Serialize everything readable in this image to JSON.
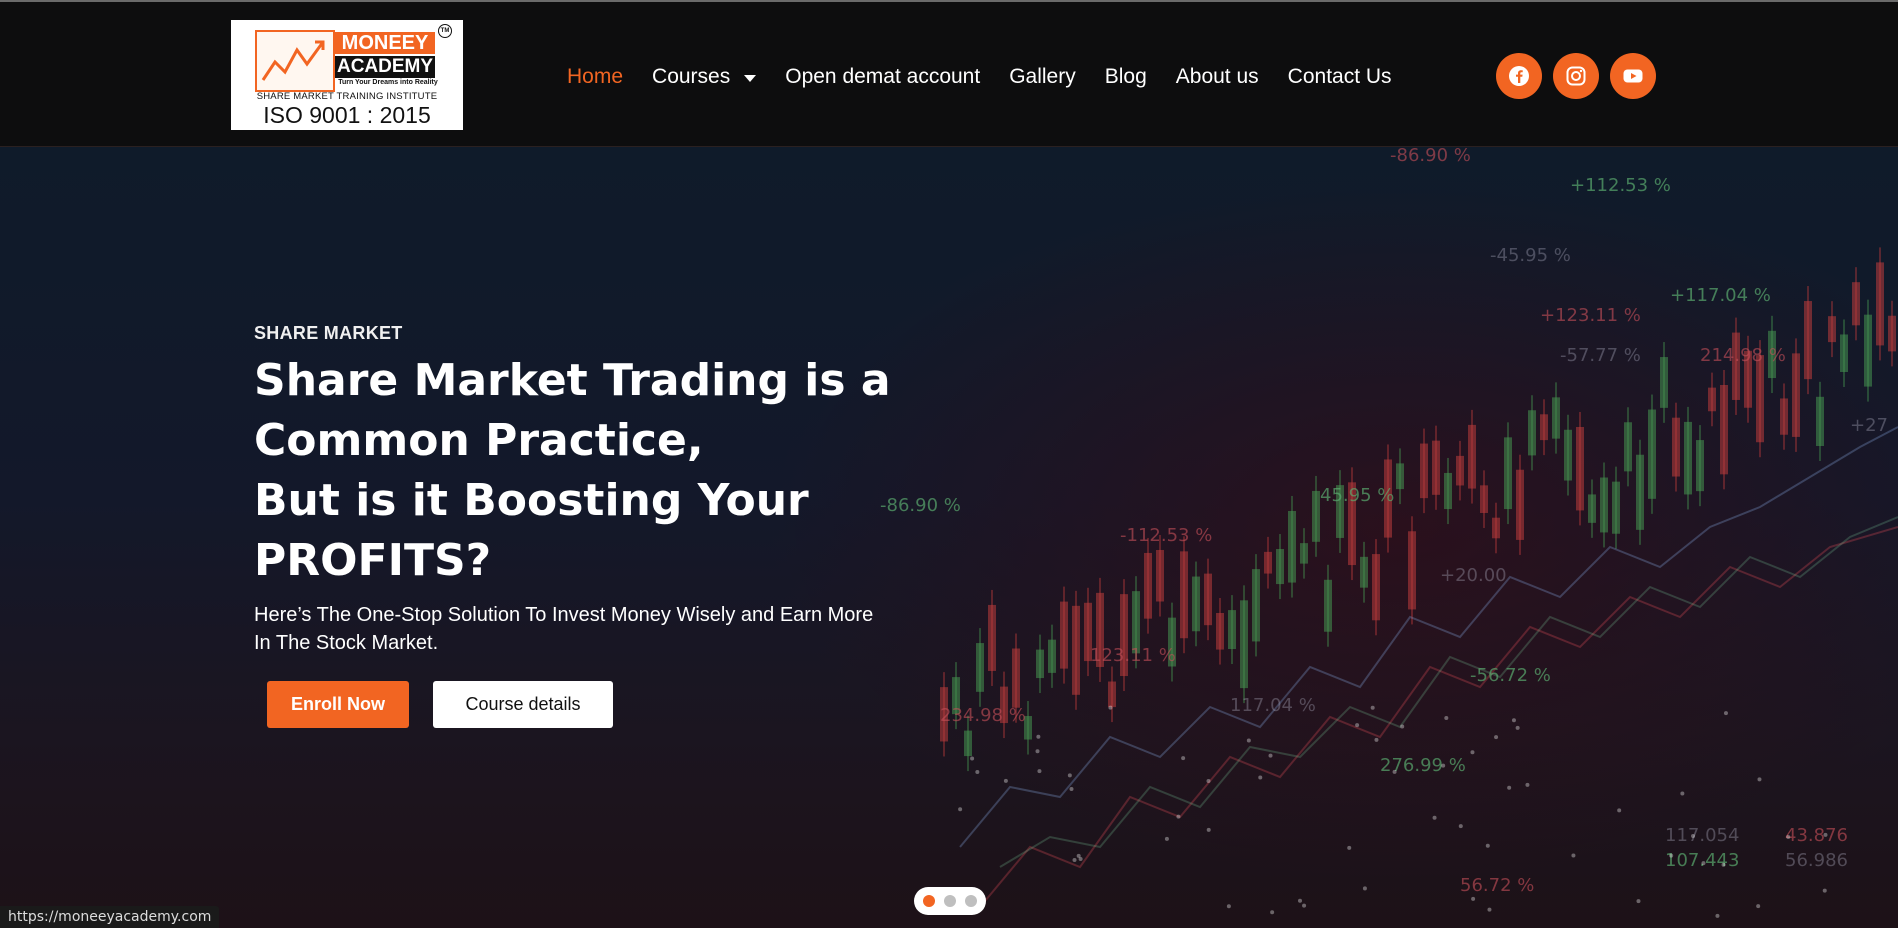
{
  "logo": {
    "name_line1": "MONEEY",
    "name_line2": "ACADEMY",
    "tagline": "Turn Your Dreams into Reality",
    "trademark": "TM",
    "institute": "SHARE MARKET TRAINING INSTITUTE",
    "iso": "ISO 9001 : 2015"
  },
  "nav": {
    "items": [
      {
        "label": "Home",
        "active": true
      },
      {
        "label": "Courses",
        "has_dropdown": true
      },
      {
        "label": "Open demat account"
      },
      {
        "label": "Gallery"
      },
      {
        "label": "Blog"
      },
      {
        "label": "About us"
      },
      {
        "label": "Contact Us"
      }
    ]
  },
  "social": [
    {
      "icon": "facebook-icon"
    },
    {
      "icon": "instagram-icon"
    },
    {
      "icon": "youtube-icon"
    }
  ],
  "hero": {
    "kicker": "SHARE MARKET",
    "headline_lines": [
      "Share Market Trading is a",
      "Common Practice,",
      "But is it Boosting Your",
      "PROFITS?"
    ],
    "subtext": "Here’s The One-Stop Solution To Invest Money Wisely and Earn More In The Stock Market.",
    "primary_button": "Enroll Now",
    "secondary_button": "Course details",
    "slides": {
      "count": 3,
      "active": 0
    },
    "background_labels": [
      "-86.90 %",
      "+112.53 %",
      "-45.95 %",
      "+123.11 %",
      "+117.04 %",
      "-57.77 %",
      "214.98 %",
      "-86.90 %",
      "+27",
      "-112.53 %",
      "45.95 %",
      "+20.00",
      "123.11 %",
      "-56.72 %",
      "117.04 %",
      "234.98 %",
      "276.99 %",
      "117.054",
      "43.876",
      "107.443",
      "56.986",
      "56.72 %"
    ]
  },
  "status_url": "https://moneeyacademy.com",
  "colors": {
    "accent": "#f26522",
    "header_bg": "#0d0d0e",
    "text": "#ffffff"
  }
}
